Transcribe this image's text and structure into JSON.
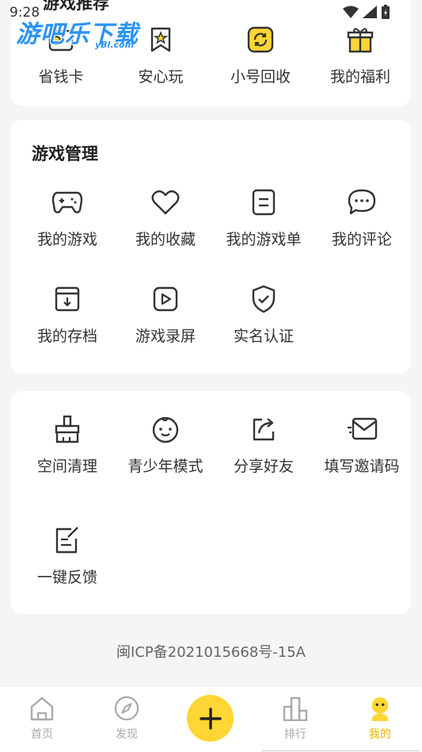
{
  "status_bar": {
    "time": "9:28"
  },
  "watermark": {
    "title": "游吧乐下载",
    "sub": "yBl.com"
  },
  "top_section": {
    "title": "游戏推荐",
    "items": [
      {
        "label": "省钱卡",
        "icon": "savings-card-icon"
      },
      {
        "label": "安心玩",
        "icon": "bookmark-star-icon"
      },
      {
        "label": "小号回收",
        "icon": "recycle-icon"
      },
      {
        "label": "我的福利",
        "icon": "gift-icon"
      }
    ]
  },
  "game_management": {
    "title": "游戏管理",
    "items": [
      {
        "label": "我的游戏",
        "icon": "gamepad-icon"
      },
      {
        "label": "我的收藏",
        "icon": "heart-icon"
      },
      {
        "label": "我的游戏单",
        "icon": "list-icon"
      },
      {
        "label": "我的评论",
        "icon": "comment-icon"
      },
      {
        "label": "我的存档",
        "icon": "archive-icon"
      },
      {
        "label": "游戏录屏",
        "icon": "play-icon"
      },
      {
        "label": "实名认证",
        "icon": "shield-check-icon"
      }
    ]
  },
  "tools": {
    "items": [
      {
        "label": "空间清理",
        "icon": "broom-icon"
      },
      {
        "label": "青少年模式",
        "icon": "child-face-icon"
      },
      {
        "label": "分享好友",
        "icon": "share-icon"
      },
      {
        "label": "填写邀请码",
        "icon": "envelope-icon"
      },
      {
        "label": "一键反馈",
        "icon": "feedback-icon"
      }
    ]
  },
  "icp": "闽ICP备2021015668号-15A",
  "tabbar": {
    "tabs": [
      {
        "label": "首页",
        "icon": "home-icon"
      },
      {
        "label": "发现",
        "icon": "compass-icon"
      },
      {
        "label": "排行",
        "icon": "ranking-icon"
      },
      {
        "label": "我的",
        "icon": "profile-icon"
      }
    ],
    "active": "我的"
  },
  "colors": {
    "accent": "#ffd633",
    "active_tab": "#f0b400",
    "watermark": "#2c93f0"
  }
}
